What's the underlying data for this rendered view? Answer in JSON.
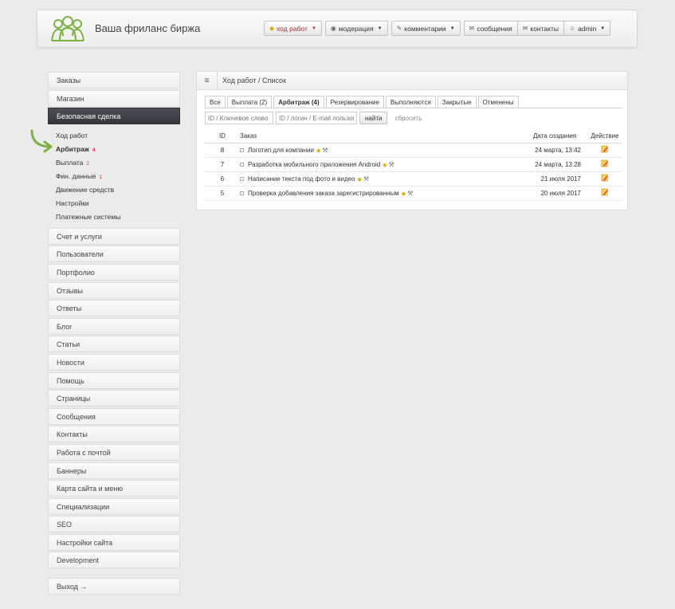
{
  "header": {
    "site_title": "Ваша фриланс биржа",
    "nav": [
      {
        "label": "ход работ",
        "icon": "shield-icon"
      },
      {
        "label": "модерация",
        "icon": "eye-icon"
      },
      {
        "label": "комментарии",
        "icon": "pencil-icon"
      },
      {
        "label": "сообщения",
        "icon": "envelope-icon"
      },
      {
        "label": "контакты",
        "icon": "envelope-icon"
      },
      {
        "label": "admin",
        "icon": "user-icon"
      }
    ]
  },
  "sidebar": {
    "top_items": [
      "Заказы",
      "Магазин"
    ],
    "active_section": "Безопасная сделка",
    "sub_items": [
      {
        "label": "Ход работ",
        "count": ""
      },
      {
        "label": "Арбитраж",
        "count": "4"
      },
      {
        "label": "Выплата",
        "count": "2"
      },
      {
        "label": "Фин. данные",
        "count": "1"
      },
      {
        "label": "Движение средств",
        "count": ""
      },
      {
        "label": "Настройки",
        "count": ""
      },
      {
        "label": "Платежные системы",
        "count": ""
      }
    ],
    "items": [
      "Счет и услуги",
      "Пользователи",
      "Портфолио",
      "Отзывы",
      "Ответы",
      "Блог",
      "Статьи",
      "Новости",
      "Помощь",
      "Страницы",
      "Сообщения",
      "Контакты",
      "Работа с почтой",
      "Баннеры",
      "Карта сайта и меню",
      "Специализации",
      "SEO",
      "Настройки сайта",
      "Development"
    ],
    "logout": "Выход →"
  },
  "main": {
    "breadcrumb": "Ход работ / Список",
    "tabs": [
      "Все",
      "Выплата (2)",
      "Арбитраж (4)",
      "Резервирование",
      "Выполняются",
      "Закрытые",
      "Отменены"
    ],
    "active_tab": "Арбитраж (4)",
    "filters": {
      "search_placeholder": "ID / Ключевое слово",
      "user_placeholder": "ID / логин / E-mail пользов",
      "find_label": "найти",
      "reset_label": "сбросить"
    },
    "table": {
      "headers": [
        "ID",
        "Заказ",
        "Дата создания",
        "Действие"
      ],
      "rows": [
        {
          "id": "8",
          "order": "Логотип для компании",
          "date": "24 марта, 13:42"
        },
        {
          "id": "7",
          "order": "Разработка мобильного приложения Android",
          "date": "24 марта, 13:28"
        },
        {
          "id": "6",
          "order": "Написание текста под фото и видео",
          "date": "21 июля 2017"
        },
        {
          "id": "5",
          "order": "Проверка добавления заказа зарегистрированным",
          "date": "20 июля 2017"
        }
      ]
    }
  },
  "colors": {
    "accent_dark": "#3a3d43",
    "logo_green": "#7cb342",
    "count_red": "#dd3333"
  }
}
